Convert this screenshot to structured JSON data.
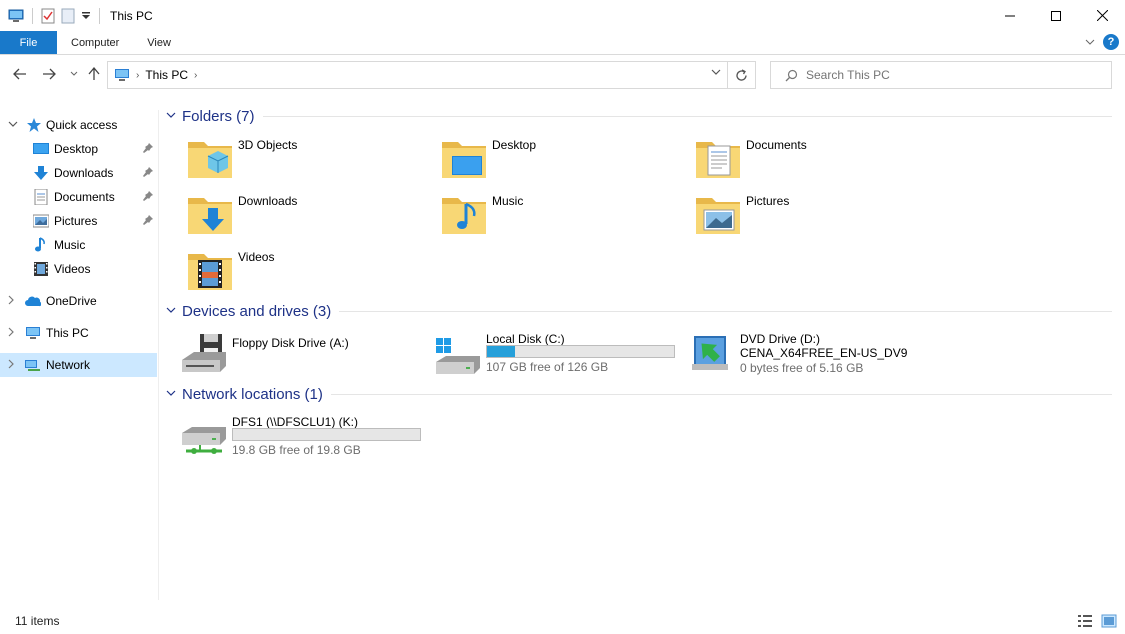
{
  "window": {
    "title": "This PC"
  },
  "ribbon": {
    "tabs": [
      "File",
      "Computer",
      "View"
    ]
  },
  "address": {
    "crumb": "This PC"
  },
  "search": {
    "placeholder": "Search This PC"
  },
  "sidebar": {
    "quick_access": "Quick access",
    "items": [
      "Desktop",
      "Downloads",
      "Documents",
      "Pictures",
      "Music",
      "Videos"
    ],
    "onedrive": "OneDrive",
    "this_pc": "This PC",
    "network": "Network"
  },
  "groups": {
    "folders": "Folders (7)",
    "devices": "Devices and drives (3)",
    "network": "Network locations (1)"
  },
  "folders": [
    "3D Objects",
    "Desktop",
    "Documents",
    "Downloads",
    "Music",
    "Pictures",
    "Videos"
  ],
  "drives": {
    "floppy": {
      "name": "Floppy Disk Drive (A:)"
    },
    "local": {
      "name": "Local Disk (C:)",
      "free": "107 GB free of 126 GB",
      "used_fraction": 0.15
    },
    "dvd": {
      "name": "DVD Drive (D:)",
      "label": "CENA_X64FREE_EN-US_DV9",
      "free": "0 bytes free of 5.16 GB"
    }
  },
  "network_locations": {
    "dfs": {
      "name": "DFS1 (\\\\DFSCLU1) (K:)",
      "free": "19.8 GB free of 19.8 GB",
      "used_fraction": 0.0
    }
  },
  "status": {
    "count": "11 items"
  },
  "colors": {
    "accent": "#1979ca",
    "group_title": "#1e3287",
    "selection": "#cce8ff",
    "bar_fill": "#26a0da"
  }
}
